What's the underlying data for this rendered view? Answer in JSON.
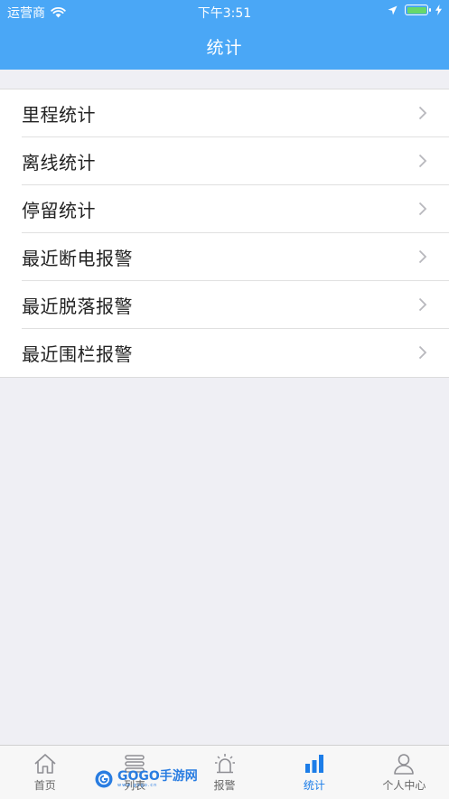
{
  "status_bar": {
    "carrier": "运营商",
    "time": "下午3:51"
  },
  "header": {
    "title": "统计"
  },
  "stats_menu": {
    "items": [
      {
        "label": "里程统计",
        "icon": "chevron-right-icon"
      },
      {
        "label": "离线统计",
        "icon": "chevron-right-icon"
      },
      {
        "label": "停留统计",
        "icon": "chevron-right-icon"
      },
      {
        "label": "最近断电报警",
        "icon": "chevron-right-icon"
      },
      {
        "label": "最近脱落报警",
        "icon": "chevron-right-icon"
      },
      {
        "label": "最近围栏报警",
        "icon": "chevron-right-icon"
      }
    ]
  },
  "tab_bar": {
    "tabs": [
      {
        "label": "首页",
        "icon": "home-icon",
        "active": false
      },
      {
        "label": "列表",
        "icon": "list-icon",
        "active": false
      },
      {
        "label": "报警",
        "icon": "alarm-icon",
        "active": false
      },
      {
        "label": "统计",
        "icon": "bar-chart-icon",
        "active": true
      },
      {
        "label": "个人中心",
        "icon": "user-icon",
        "active": false
      }
    ]
  },
  "watermark": {
    "brand": "GOGO手游网",
    "domain": "www.gogo.cn"
  },
  "colors": {
    "header_bg": "#4aa7f6",
    "active_tab": "#1c7de8",
    "page_bg": "#efeff4",
    "battery": "#67d86b"
  }
}
